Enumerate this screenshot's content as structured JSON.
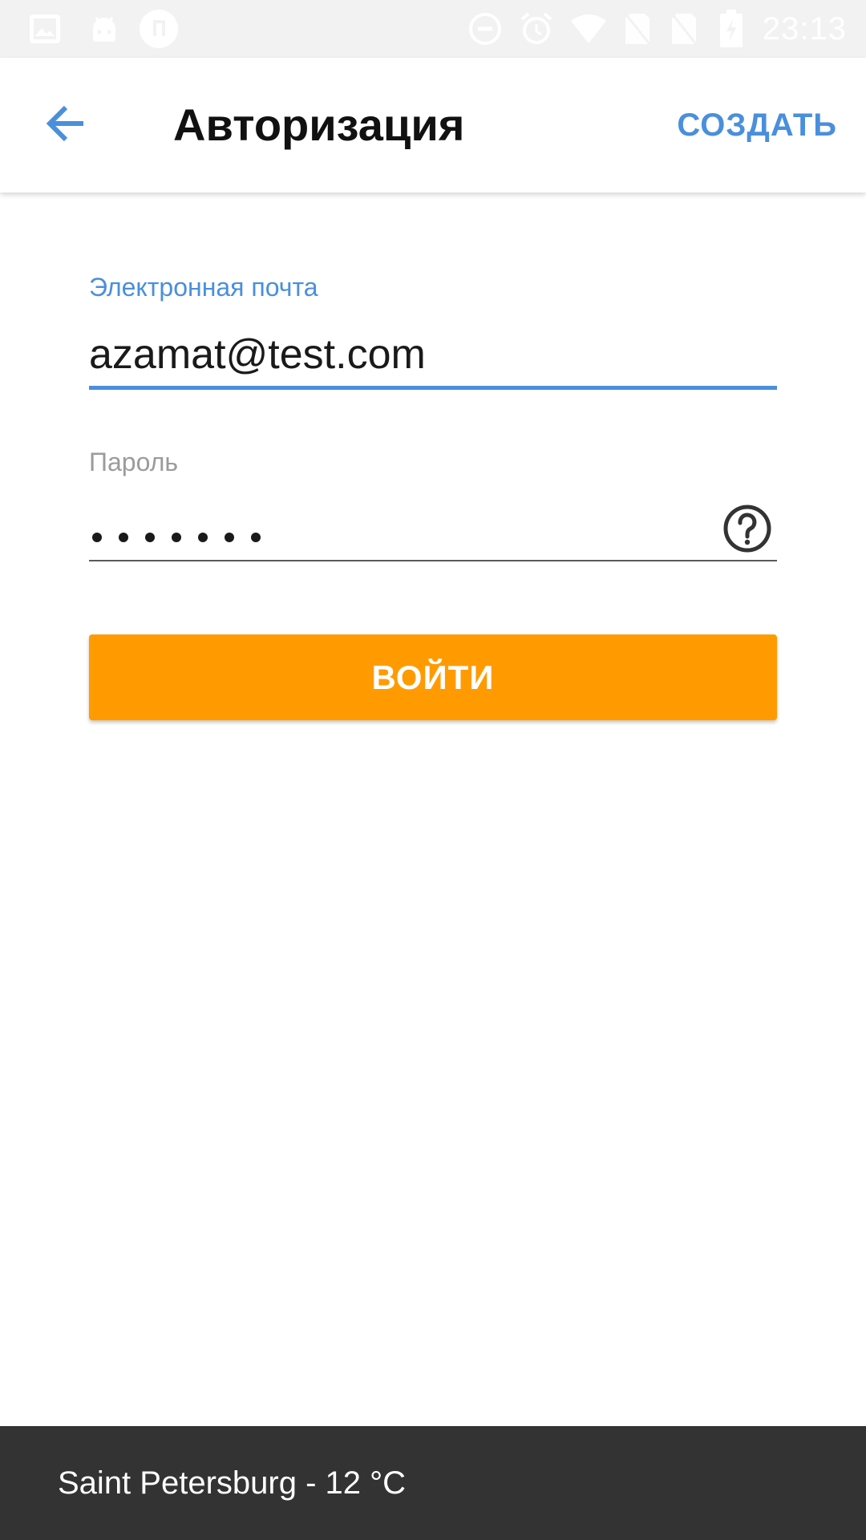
{
  "status_bar": {
    "time": "23:13",
    "left_icons": [
      "image-icon",
      "android-icon",
      "music-note-icon"
    ],
    "right_icons": [
      "do-not-disturb-icon",
      "alarm-icon",
      "wifi-icon",
      "no-sim-icon",
      "no-sim-icon",
      "battery-charging-icon"
    ]
  },
  "app_bar": {
    "back_icon": "arrow-left-icon",
    "title": "Авторизация",
    "create_label": "СОЗДАТЬ"
  },
  "form": {
    "email": {
      "label": "Электронная почта",
      "value": "azamat@test.com"
    },
    "password": {
      "label": "Пароль",
      "masked_length": 7,
      "help_icon": "help-circle-icon"
    },
    "login_label": "ВОЙТИ"
  },
  "snackbar": {
    "text": "Saint Petersburg - 12 °C"
  },
  "colors": {
    "accent_blue": "#4a8fdb",
    "button_orange": "#ff9b00",
    "snackbar_bg": "#333333",
    "status_bar_bg": "#f2f2f2"
  }
}
